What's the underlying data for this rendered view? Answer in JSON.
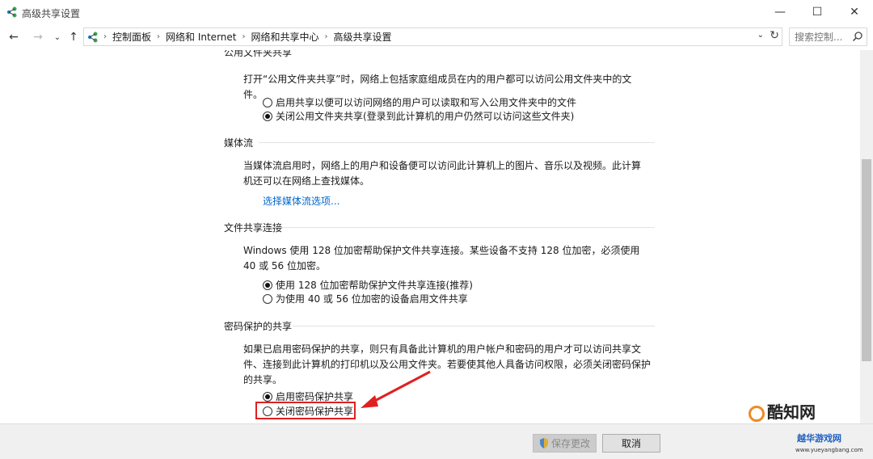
{
  "window": {
    "title": "高级共享设置",
    "minimize_glyph": "—",
    "maximize_glyph": "☐",
    "close_glyph": "✕"
  },
  "nav": {
    "back_glyph": "←",
    "forward_glyph": "→",
    "recent_glyph": "⌄",
    "up_glyph": "↑",
    "breadcrumbs": [
      "控制面板",
      "网络和 Internet",
      "网络和共享中心",
      "高级共享设置"
    ],
    "separator": "›",
    "dropdown_glyph": "⌄",
    "refresh_glyph": "↻",
    "search_placeholder": "搜索控制..."
  },
  "sections": {
    "public_folder": {
      "heading": "公用文件夹共享",
      "description": "打开“公用文件夹共享”时，网络上包括家庭组成员在内的用户都可以访问公用文件夹中的文件。",
      "options": [
        {
          "label": "启用共享以便可以访问网络的用户可以读取和写入公用文件夹中的文件",
          "checked": false
        },
        {
          "label": "关闭公用文件夹共享(登录到此计算机的用户仍然可以访问这些文件夹)",
          "checked": true
        }
      ]
    },
    "media_streaming": {
      "heading": "媒体流",
      "description": "当媒体流启用时，网络上的用户和设备便可以访问此计算机上的图片、音乐以及视频。此计算机还可以在网络上查找媒体。",
      "link": "选择媒体流选项..."
    },
    "file_sharing": {
      "heading": "文件共享连接",
      "description": "Windows 使用 128 位加密帮助保护文件共享连接。某些设备不支持 128 位加密，必须使用 40 或 56 位加密。",
      "options": [
        {
          "label": "使用 128 位加密帮助保护文件共享连接(推荐)",
          "checked": true
        },
        {
          "label": "为使用 40 或 56 位加密的设备启用文件共享",
          "checked": false
        }
      ]
    },
    "password_protected": {
      "heading": "密码保护的共享",
      "description": "如果已启用密码保护的共享，则只有具备此计算机的用户帐户和密码的用户才可以访问共享文件、连接到此计算机的打印机以及公用文件夹。若要使其他人具备访问权限，必须关闭密码保护的共享。",
      "options": [
        {
          "label": "启用密码保护共享",
          "checked": true
        },
        {
          "label": "关闭密码保护共享",
          "checked": false
        }
      ]
    }
  },
  "buttons": {
    "save": "保存更改",
    "cancel": "取消"
  },
  "watermark": {
    "brand": "酷知网",
    "site_label": "越华游戏网",
    "site_url": "www.yueyangbang.com"
  },
  "colors": {
    "link": "#0066cc",
    "highlight": "#e02020"
  }
}
